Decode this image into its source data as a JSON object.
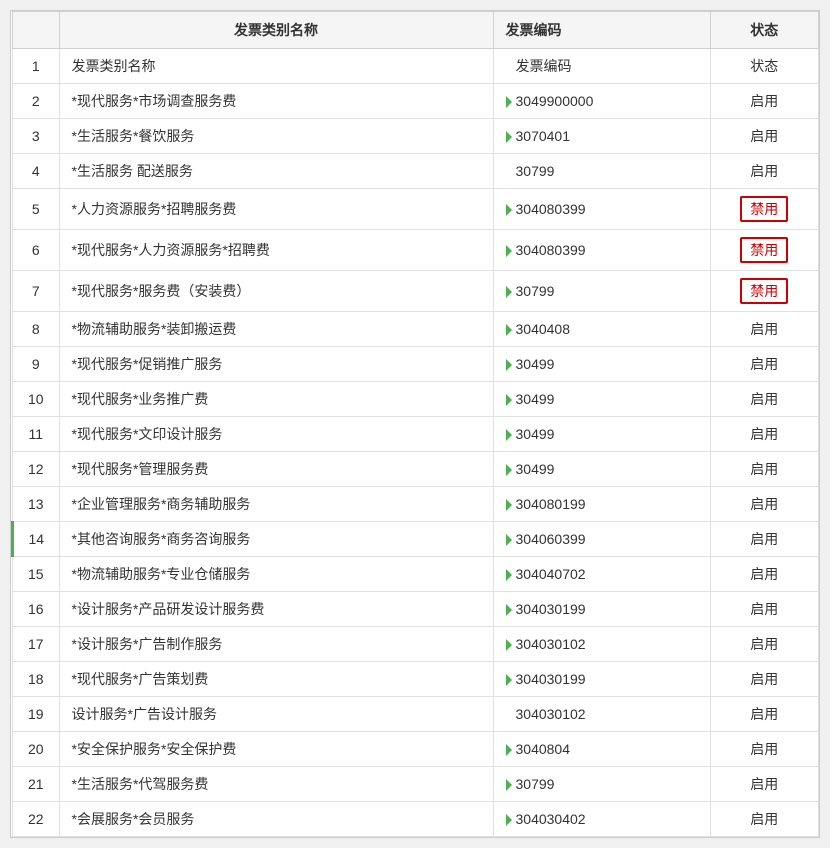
{
  "table": {
    "headers": [
      "",
      "发票类别名称",
      "发票编码",
      "状态"
    ],
    "rows": [
      {
        "num": "1",
        "name": "发票类别名称",
        "code": "发票编码",
        "status": "状态",
        "is_header": true
      },
      {
        "num": "2",
        "name": "*现代服务*市场调查服务费",
        "code": "3049900000",
        "status": "启用",
        "disabled": false,
        "has_marker": true
      },
      {
        "num": "3",
        "name": "*生活服务*餐饮服务",
        "code": "3070401",
        "status": "启用",
        "disabled": false,
        "has_marker": true
      },
      {
        "num": "4",
        "name": "*生活服务 配送服务",
        "code": "30799",
        "status": "启用",
        "disabled": false,
        "has_marker": false
      },
      {
        "num": "5",
        "name": "*人力资源服务*招聘服务费",
        "code": "304080399",
        "status": "禁用",
        "disabled": true,
        "has_marker": true
      },
      {
        "num": "6",
        "name": "*现代服务*人力资源服务*招聘费",
        "code": "304080399",
        "status": "禁用",
        "disabled": true,
        "has_marker": true
      },
      {
        "num": "7",
        "name": "*现代服务*服务费（安装费）",
        "code": "30799",
        "status": "禁用",
        "disabled": true,
        "has_marker": true
      },
      {
        "num": "8",
        "name": "*物流辅助服务*装卸搬运费",
        "code": "3040408",
        "status": "启用",
        "disabled": false,
        "has_marker": true
      },
      {
        "num": "9",
        "name": "*现代服务*促销推广服务",
        "code": "30499",
        "status": "启用",
        "disabled": false,
        "has_marker": true
      },
      {
        "num": "10",
        "name": "*现代服务*业务推广费",
        "code": "30499",
        "status": "启用",
        "disabled": false,
        "has_marker": true
      },
      {
        "num": "11",
        "name": "*现代服务*文印设计服务",
        "code": "30499",
        "status": "启用",
        "disabled": false,
        "has_marker": true
      },
      {
        "num": "12",
        "name": "*现代服务*管理服务费",
        "code": "30499",
        "status": "启用",
        "disabled": false,
        "has_marker": true
      },
      {
        "num": "13",
        "name": "*企业管理服务*商务辅助服务",
        "code": "304080199",
        "status": "启用",
        "disabled": false,
        "has_marker": true
      },
      {
        "num": "14",
        "name": "*其他咨询服务*商务咨询服务",
        "code": "304060399",
        "status": "启用",
        "disabled": false,
        "has_marker": true,
        "highlight": true
      },
      {
        "num": "15",
        "name": "*物流辅助服务*专业仓储服务",
        "code": "304040702",
        "status": "启用",
        "disabled": false,
        "has_marker": true
      },
      {
        "num": "16",
        "name": "*设计服务*产品研发设计服务费",
        "code": "304030199",
        "status": "启用",
        "disabled": false,
        "has_marker": true
      },
      {
        "num": "17",
        "name": "*设计服务*广告制作服务",
        "code": "304030102",
        "status": "启用",
        "disabled": false,
        "has_marker": true
      },
      {
        "num": "18",
        "name": "*现代服务*广告策划费",
        "code": "304030199",
        "status": "启用",
        "disabled": false,
        "has_marker": true
      },
      {
        "num": "19",
        "name": "设计服务*广告设计服务",
        "code": "304030102",
        "status": "启用",
        "disabled": false,
        "has_marker": false
      },
      {
        "num": "20",
        "name": "*安全保护服务*安全保护费",
        "code": "3040804",
        "status": "启用",
        "disabled": false,
        "has_marker": true
      },
      {
        "num": "21",
        "name": "*生活服务*代驾服务费",
        "code": "30799",
        "status": "启用",
        "disabled": false,
        "has_marker": true
      },
      {
        "num": "22",
        "name": "*会展服务*会员服务",
        "code": "304030402",
        "status": "启用",
        "disabled": false,
        "has_marker": true
      }
    ]
  }
}
